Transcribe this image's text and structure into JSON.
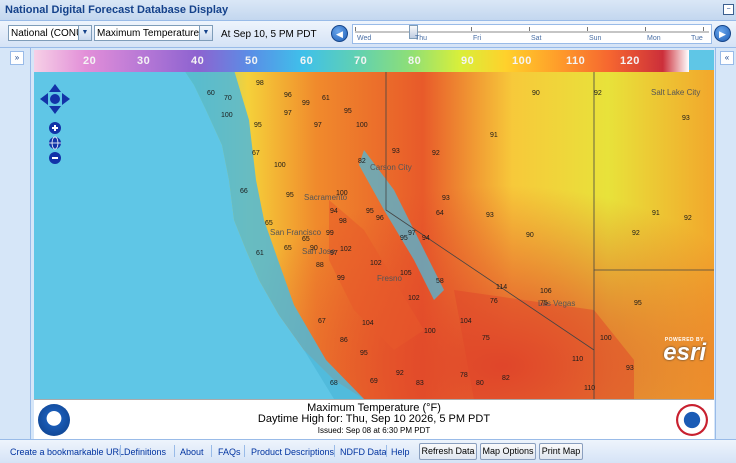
{
  "app": {
    "title": "National Digital Forecast Database Display"
  },
  "toolbar": {
    "region_value": "National (CONUS",
    "element_value": "Maximum Temperature (°F",
    "time_label": "At Sep 10,   5 PM PDT"
  },
  "timeline": {
    "days": [
      "Wed",
      "Thu",
      "Fri",
      "Sat",
      "Sun",
      "Mon",
      "Tue"
    ]
  },
  "colorbar": {
    "labels": [
      "20",
      "30",
      "40",
      "50",
      "60",
      "70",
      "80",
      "90",
      "100",
      "110",
      "120"
    ]
  },
  "map": {
    "places": [
      "Sacramento",
      "Carson City",
      "San Francisco",
      "San Jose",
      "Fresno",
      "Salt Lake City",
      "Las Vegas"
    ],
    "temps": [
      "60",
      "70",
      "98",
      "96",
      "99",
      "61",
      "100",
      "95",
      "97",
      "97",
      "95",
      "100",
      "67",
      "100",
      "82",
      "93",
      "92",
      "91",
      "90",
      "92",
      "93",
      "66",
      "95",
      "100",
      "94",
      "95",
      "65",
      "98",
      "96",
      "97",
      "93",
      "93",
      "90",
      "65",
      "90",
      "99",
      "97",
      "95",
      "64",
      "61",
      "102",
      "65",
      "88",
      "99",
      "102",
      "105",
      "94",
      "92",
      "58",
      "114",
      "76",
      "106",
      "75",
      "91",
      "92",
      "102",
      "104",
      "67",
      "100",
      "104",
      "86",
      "95",
      "75",
      "110",
      "100",
      "95",
      "68",
      "69",
      "92",
      "78",
      "80",
      "110",
      "93",
      "83",
      "82"
    ],
    "brand": "esri",
    "brand_tagline": "POWERED BY",
    "colors": {
      "water": "#5fc6e6",
      "hot": "#e85a2a",
      "warm": "#f7c93a",
      "cool": "#4fb8d9"
    }
  },
  "caption": {
    "line1": "Maximum Temperature (°F)",
    "line2": "Daytime High for: Thu, Sep 10 2026,   5 PM PDT",
    "line3": "Issued: Sep 08 at 6:30 PM PDT"
  },
  "status": {
    "bookmark": "Create a bookmarkable URL",
    "definitions": "Definitions",
    "about": "About",
    "faqs": "FAQs",
    "product": "Product Descriptions",
    "ndfd": "NDFD Data",
    "help": "Help",
    "refresh": "Refresh Data",
    "map_options": "Map Options",
    "print_map": "Print Map"
  }
}
